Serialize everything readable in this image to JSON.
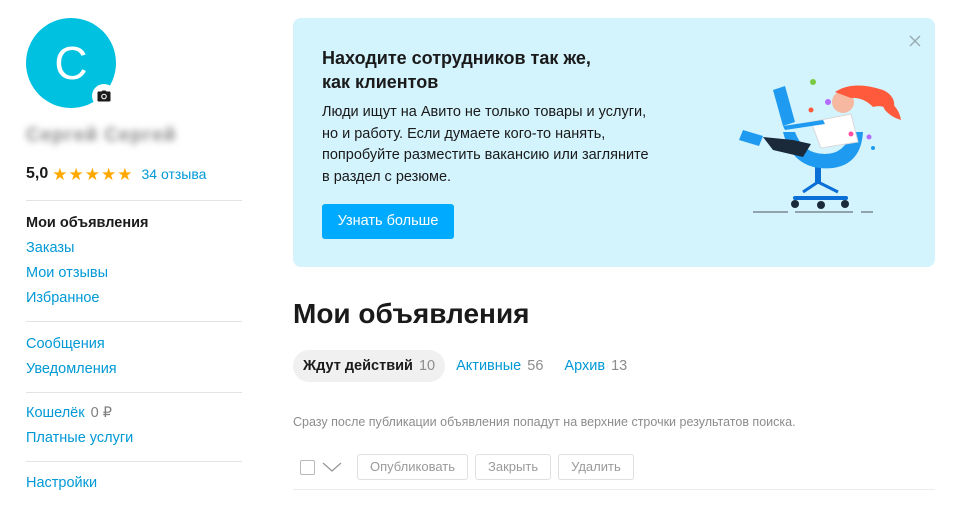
{
  "profile": {
    "avatar_letter": "C",
    "name": "Сергей Сергей",
    "rating_value": "5,0",
    "stars": 5,
    "reviews_link": "34 отзыва"
  },
  "sidebar": {
    "group1": [
      {
        "label": "Мои объявления",
        "active": true
      },
      {
        "label": "Заказы"
      },
      {
        "label": "Мои отзывы"
      },
      {
        "label": "Избранное"
      }
    ],
    "group2": [
      {
        "label": "Сообщения"
      },
      {
        "label": "Уведомления"
      }
    ],
    "group3": [
      {
        "label": "Кошелёк",
        "amount": "0 ₽"
      },
      {
        "label": "Платные услуги"
      }
    ],
    "group4": [
      {
        "label": "Настройки"
      }
    ]
  },
  "banner": {
    "title_line1": "Находите сотрудников так же,",
    "title_line2": "как клиентов",
    "text_lines": [
      "Люди ищут на Авито не только товары и услуги,",
      "но и работу. Если думаете кого-то нанять,",
      "попробуйте разместить вакансию или загляните",
      "в раздел с резюме."
    ],
    "button": "Узнать больше",
    "close_icon": "close-icon",
    "illustration": "person-on-chair-with-laptop"
  },
  "main": {
    "title": "Мои объявления",
    "tabs": [
      {
        "label": "Ждут действий",
        "count": "10",
        "active": true
      },
      {
        "label": "Активные",
        "count": "56"
      },
      {
        "label": "Архив",
        "count": "13"
      }
    ],
    "hint": "Сразу после публикации объявления попадут на верхние строчки результатов поиска.",
    "actions": {
      "publish": "Опубликовать",
      "close": "Закрыть",
      "delete": "Удалить"
    }
  },
  "colors": {
    "accent_link": "#0099d6",
    "avatar_bg": "#00c1df",
    "banner_bg": "#d3f3fd",
    "button_bg": "#00aaff",
    "star": "#ffa900"
  }
}
